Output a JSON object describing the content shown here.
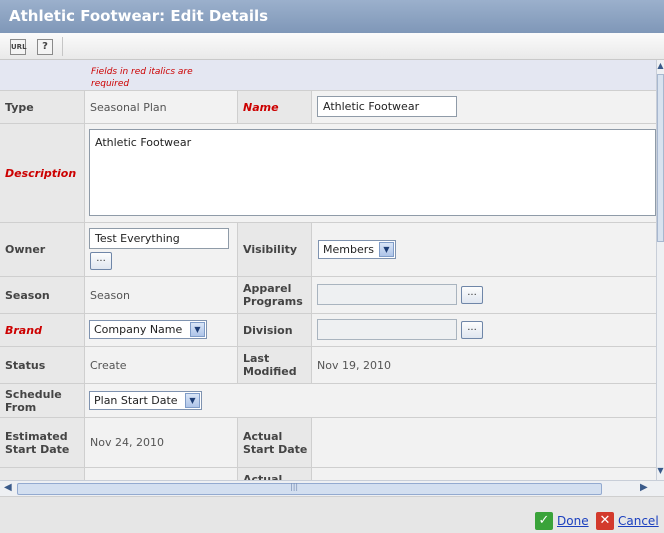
{
  "window": {
    "title": "Athletic Footwear: Edit Details"
  },
  "toolbar": {
    "url_icon_text": "URL",
    "help_icon_text": "?"
  },
  "note": "Fields in red italics are required",
  "fields": {
    "type": {
      "label": "Type",
      "value": "Seasonal Plan"
    },
    "name": {
      "label": "Name",
      "value": "Athletic Footwear"
    },
    "description": {
      "label": "Description",
      "value": "Athletic Footwear"
    },
    "owner": {
      "label": "Owner",
      "value": "Test Everything",
      "browse": "..."
    },
    "visibility": {
      "label": "Visibility",
      "value": "Members"
    },
    "season": {
      "label": "Season",
      "value": "Season"
    },
    "apparel_programs": {
      "label": "Apparel Programs",
      "value": "",
      "browse": "..."
    },
    "brand": {
      "label": "Brand",
      "value": "Company Name"
    },
    "division": {
      "label": "Division",
      "value": "",
      "browse": "..."
    },
    "status": {
      "label": "Status",
      "value": "Create"
    },
    "last_modified": {
      "label": "Last Modified",
      "value": "Nov 19, 2010"
    },
    "schedule_from": {
      "label": "Schedule From",
      "value": "Plan Start Date"
    },
    "estimated_start": {
      "label": "Estimated Start Date",
      "value": "Nov 24, 2010"
    },
    "actual_start": {
      "label": "Actual Start Date",
      "value": ""
    },
    "actual_next": {
      "label": "Actual"
    }
  },
  "footer": {
    "done": "Done",
    "cancel": "Cancel"
  },
  "colors": {
    "title_bg": "#8aa0c0",
    "required": "#cc0000",
    "link": "#1a3fbf",
    "done_icon": "#3aa33a",
    "cancel_icon": "#d33a2c"
  },
  "icons": {
    "done": "checkmark-icon",
    "cancel": "x-icon"
  }
}
